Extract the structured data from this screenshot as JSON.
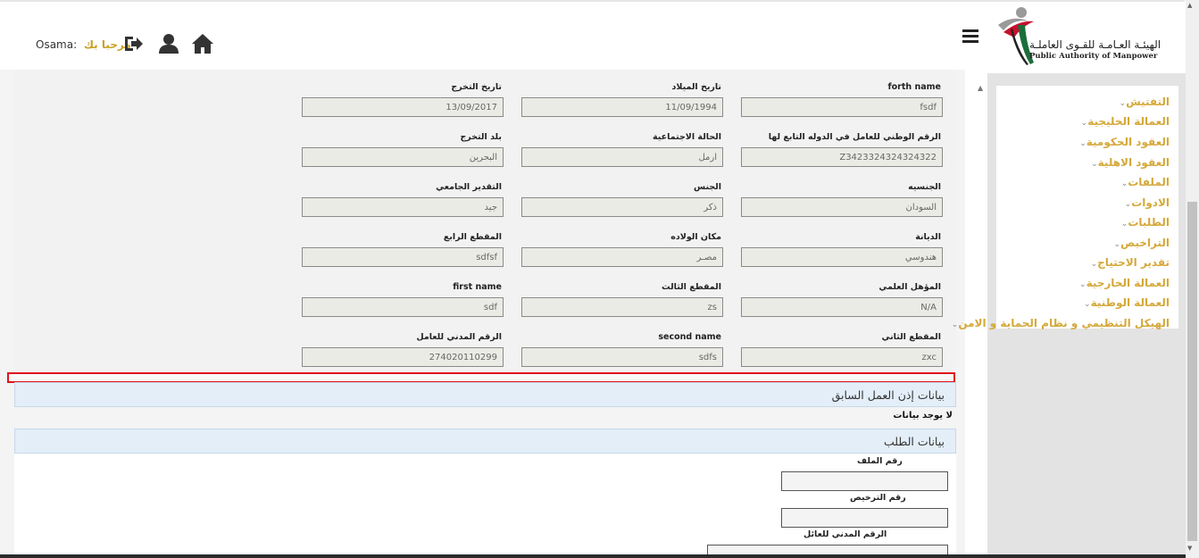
{
  "header": {
    "user_name": "Osama:",
    "welcome": "مرحبا بك",
    "logo_ar": "الهيئـة العـامـة للقـوى العاملـة",
    "logo_en": "Public Authority of Manpower",
    "icons": [
      "logout-icon",
      "user-icon",
      "home-icon",
      "menu-icon"
    ]
  },
  "fields": [
    {
      "label": "forth name",
      "value": "fsdf"
    },
    {
      "label": "تاريخ الميلاد",
      "value": "11/09/1994"
    },
    {
      "label": "تاريخ التخرج",
      "value": "13/09/2017"
    },
    {
      "label": "الرقم الوطني للعامل في الدوله التابع لها",
      "value": "Z3423324324324322"
    },
    {
      "label": "الحالة الاجتماعية",
      "value": "ارمل"
    },
    {
      "label": "بلد التخرج",
      "value": "البحرين"
    },
    {
      "label": "الجنسيه",
      "value": "السودان"
    },
    {
      "label": "الجنس",
      "value": "ذكر"
    },
    {
      "label": "التقدير الجامعي",
      "value": "جيد"
    },
    {
      "label": "الديانة",
      "value": "هندوسي"
    },
    {
      "label": "مكان الولاده",
      "value": "مصـر"
    },
    {
      "label": "المقطع الرابع",
      "value": "sdfsf"
    },
    {
      "label": "المؤهل العلمي",
      "value": "N/A"
    },
    {
      "label": "المقطع الثالث",
      "value": "zs"
    },
    {
      "label": "first name",
      "value": "sdf"
    },
    {
      "label": "المقطع الثاني",
      "value": "zxc"
    },
    {
      "label": "second name",
      "value": "sdfs"
    },
    {
      "label": "الرقم المدني للعامل",
      "value": "274020110299"
    }
  ],
  "previous_permit": {
    "title": "بيانات إذن العمل السابق",
    "no_data": "لا يوجد بيانات"
  },
  "request": {
    "title": "بيانات الطلب",
    "file_number_label": "رقم الملف",
    "license_number_label": "رقم الترخيص",
    "guardian_civil_id_label": "الرقم المدني للعائل"
  },
  "sidebar": {
    "items": [
      "التفتيش",
      "العمالة الخليجية",
      "العقود الحكومية",
      "العقود الاهلية",
      "الملفات",
      "الادوات",
      "الطلبات",
      "التراخيص",
      "تقدير الاحتياج",
      "العمالة الخارجية",
      "العمالة الوطنية",
      "الهيكل التنظيمي و نظام الحماية و الامن"
    ]
  },
  "colors": {
    "accent_gold": "#d4a93b",
    "section_header_bg": "#e3eef8",
    "highlight_red": "#e0131b"
  }
}
